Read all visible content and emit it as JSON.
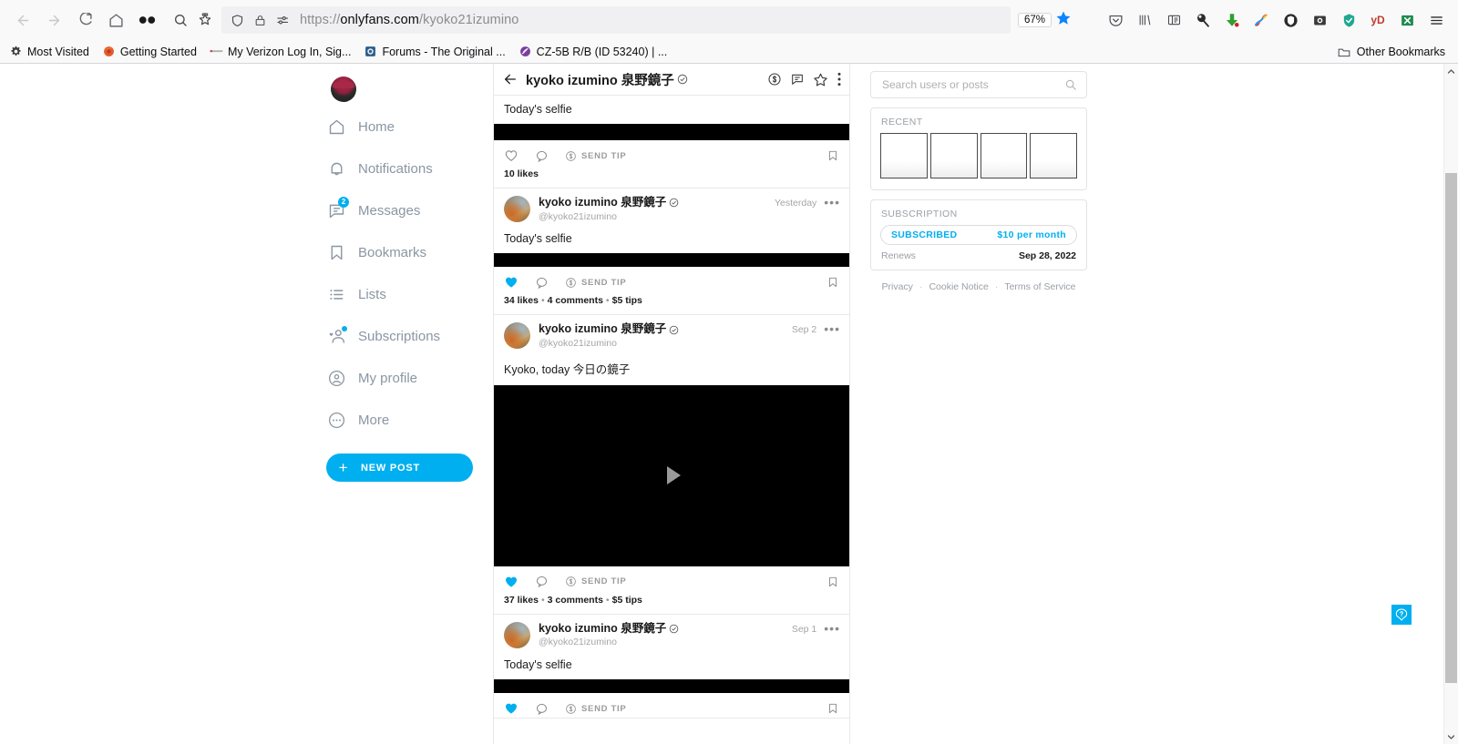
{
  "browser": {
    "url_scheme": "https://",
    "url_host": "onlyfans.com",
    "url_path": "/kyoko21izumino",
    "zoom_level": "67%",
    "nav_icons": [
      "back-arrow",
      "forward-arrow",
      "reload",
      "home",
      "infinity-extension"
    ],
    "url_left_icons": [
      "search-icon",
      "page-action-icon",
      "shield-icon",
      "lock-icon",
      "permissions-icon"
    ],
    "extension_icons": [
      "pocket-icon",
      "library-icon",
      "reader-view-icon",
      "lollipop-icon",
      "download-arrow-icon",
      "skype-icon",
      "bitwarden-icon",
      "video-download-icon",
      "shield-green-icon",
      "yd-icon",
      "excel-icon",
      "hamburger-menu-icon"
    ],
    "bookmarks": [
      {
        "label": "Most Visited",
        "icon": "gear-icon"
      },
      {
        "label": "Getting Started",
        "icon": "firefox-icon"
      },
      {
        "label": "My Verizon Log In, Sig...",
        "icon": "verizon-icon"
      },
      {
        "label": "Forums - The Original ...",
        "icon": "forum-icon"
      },
      {
        "label": "CZ-5B R/B (ID 53240) | ...",
        "icon": "satellite-icon"
      }
    ],
    "other_bookmarks_label": "Other Bookmarks"
  },
  "sidebar": {
    "avatar_name": "user-avatar",
    "items": [
      {
        "label": "Home",
        "icon": "home-icon",
        "badge": null
      },
      {
        "label": "Notifications",
        "icon": "bell-icon",
        "badge": null
      },
      {
        "label": "Messages",
        "icon": "message-icon",
        "badge": "2"
      },
      {
        "label": "Bookmarks",
        "icon": "bookmark-icon",
        "badge": null
      },
      {
        "label": "Lists",
        "icon": "list-icon",
        "badge": null
      },
      {
        "label": "Subscriptions",
        "icon": "subscriptions-icon",
        "badge": "dot"
      },
      {
        "label": "My profile",
        "icon": "profile-icon",
        "badge": null
      },
      {
        "label": "More",
        "icon": "more-icon",
        "badge": null
      }
    ],
    "new_post_label": "NEW POST"
  },
  "feed": {
    "header": {
      "back_icon": "back-arrow-icon",
      "title": "kyoko izumino 泉野鏡子",
      "verified": true,
      "actions": [
        "tip-icon",
        "message-icon",
        "star-icon",
        "more-vertical-icon"
      ]
    },
    "posts": [
      {
        "partial_top": true,
        "text": "Today's selfie",
        "media": "image",
        "media_height": 18,
        "liked": false,
        "tip_label": "SEND TIP",
        "stats": "10 likes",
        "stats_parts": [
          "10 likes"
        ]
      },
      {
        "author": "kyoko izumino 泉野鏡子",
        "handle": "@kyoko21izumino",
        "date": "Yesterday",
        "text": "Today's selfie",
        "media": "image",
        "media_height": 15,
        "liked": true,
        "tip_label": "SEND TIP",
        "stats_parts": [
          "34 likes",
          "4 comments",
          "$5 tips"
        ]
      },
      {
        "author": "kyoko izumino 泉野鏡子",
        "handle": "@kyoko21izumino",
        "date": "Sep 2",
        "text": "Kyoko, today 今日の鏡子",
        "media": "video",
        "media_height": 199,
        "liked": true,
        "tip_label": "SEND TIP",
        "stats_parts": [
          "37 likes",
          "3 comments",
          "$5 tips"
        ]
      },
      {
        "author": "kyoko izumino 泉野鏡子",
        "handle": "@kyoko21izumino",
        "date": "Sep 1",
        "text": "Today's selfie",
        "media": "image",
        "media_height": 15,
        "liked": true,
        "tip_label": "SEND TIP",
        "stats_parts": []
      }
    ]
  },
  "right": {
    "search_placeholder": "Search users or posts",
    "search_value": "",
    "recent_label": "RECENT",
    "recent_count": 4,
    "subscription_label": "SUBSCRIPTION",
    "subscribed_label": "SUBSCRIBED",
    "price_label": "$10 per month",
    "renews_label": "Renews",
    "renews_date": "Sep 28, 2022",
    "footer": [
      "Privacy",
      "Cookie Notice",
      "Terms of Service"
    ]
  },
  "help": {
    "icon": "help-chat-icon"
  },
  "colors": {
    "accent": "#00aff0",
    "text": "#1a1a1a",
    "muted": "#8a96a3",
    "border": "#e8e8e8"
  }
}
